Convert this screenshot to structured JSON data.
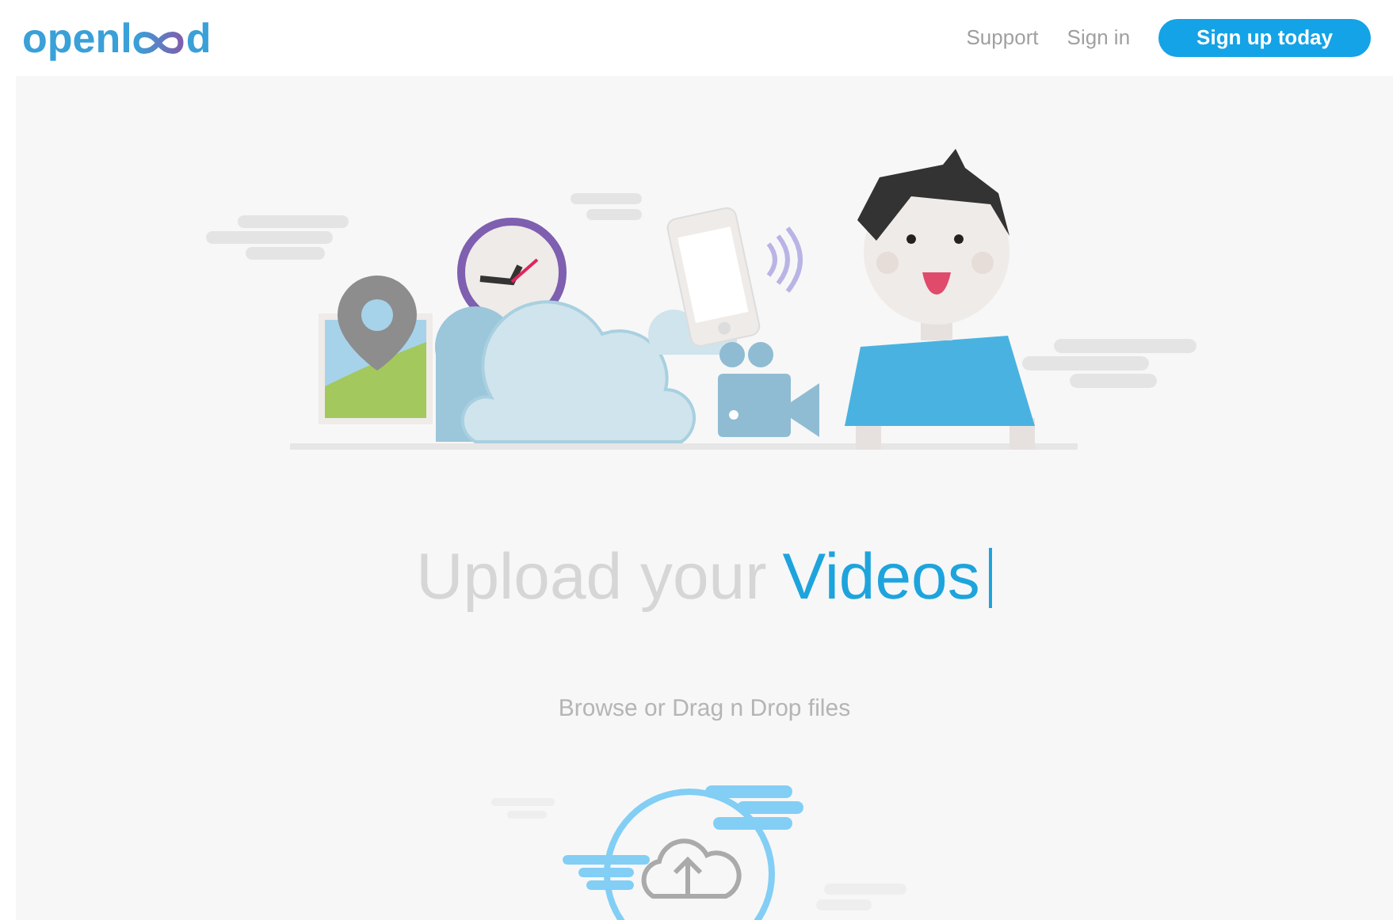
{
  "header": {
    "logo": {
      "before": "openl",
      "after": "d"
    },
    "nav_links": [
      "Support",
      "Sign in"
    ],
    "signup_button": "Sign up today"
  },
  "hero": {
    "heading": {
      "text": "Upload your",
      "highlight": "Videos"
    },
    "subtitle": "Browse or Drag n Drop files"
  }
}
